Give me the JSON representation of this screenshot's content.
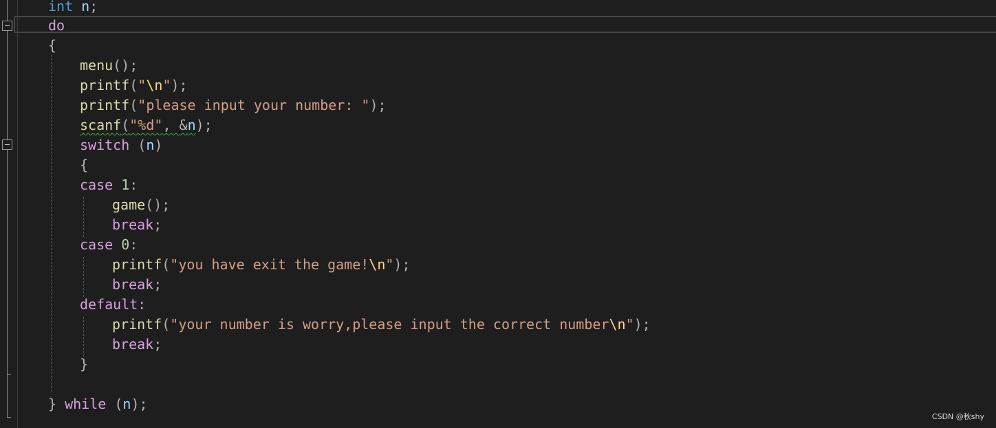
{
  "editor": {
    "lines": [
      {
        "tokens": [
          {
            "t": "int",
            "c": "kw"
          },
          {
            "t": " "
          },
          {
            "t": "n",
            "c": "var"
          },
          {
            "t": ";",
            "c": "punct"
          }
        ]
      },
      {
        "tokens": [
          {
            "t": "do",
            "c": "ctrl"
          }
        ]
      },
      {
        "tokens": [
          {
            "t": "{",
            "c": "punct"
          }
        ]
      },
      {
        "tokens": [
          {
            "t": "menu",
            "c": "fn"
          },
          {
            "t": "();",
            "c": "punct"
          }
        ]
      },
      {
        "tokens": [
          {
            "t": "printf",
            "c": "fn"
          },
          {
            "t": "(",
            "c": "punct"
          },
          {
            "t": "\"",
            "c": "str"
          },
          {
            "t": "\\n",
            "c": "esc"
          },
          {
            "t": "\"",
            "c": "str"
          },
          {
            "t": ");",
            "c": "punct"
          }
        ]
      },
      {
        "tokens": [
          {
            "t": "printf",
            "c": "fn"
          },
          {
            "t": "(",
            "c": "punct"
          },
          {
            "t": "\"please input your number: \"",
            "c": "str"
          },
          {
            "t": ");",
            "c": "punct"
          }
        ]
      },
      {
        "tokens": [
          {
            "t": "scanf",
            "c": "fn",
            "sq": true
          },
          {
            "t": "(",
            "c": "punct",
            "sq": true
          },
          {
            "t": "\"%d\"",
            "c": "str",
            "sq": true
          },
          {
            "t": ", ",
            "c": "punct",
            "sq": true
          },
          {
            "t": "&",
            "c": "punct",
            "sq": true
          },
          {
            "t": "n",
            "c": "var",
            "sq": true
          },
          {
            "t": ");",
            "c": "punct"
          }
        ]
      },
      {
        "tokens": [
          {
            "t": "switch",
            "c": "ctrl"
          },
          {
            "t": " (",
            "c": "punct"
          },
          {
            "t": "n",
            "c": "var"
          },
          {
            "t": ")",
            "c": "punct"
          }
        ]
      },
      {
        "tokens": [
          {
            "t": "{",
            "c": "punct"
          }
        ]
      },
      {
        "tokens": [
          {
            "t": "case",
            "c": "ctrl"
          },
          {
            "t": " "
          },
          {
            "t": "1",
            "c": "num"
          },
          {
            "t": ":",
            "c": "punct"
          }
        ]
      },
      {
        "tokens": [
          {
            "t": "game",
            "c": "fn"
          },
          {
            "t": "();",
            "c": "punct"
          }
        ]
      },
      {
        "tokens": [
          {
            "t": "break",
            "c": "ctrl"
          },
          {
            "t": ";",
            "c": "punct"
          }
        ]
      },
      {
        "tokens": [
          {
            "t": "case",
            "c": "ctrl"
          },
          {
            "t": " "
          },
          {
            "t": "0",
            "c": "num"
          },
          {
            "t": ":",
            "c": "punct"
          }
        ]
      },
      {
        "tokens": [
          {
            "t": "printf",
            "c": "fn"
          },
          {
            "t": "(",
            "c": "punct"
          },
          {
            "t": "\"you have exit the game!",
            "c": "str"
          },
          {
            "t": "\\n",
            "c": "esc"
          },
          {
            "t": "\"",
            "c": "str"
          },
          {
            "t": ");",
            "c": "punct"
          }
        ]
      },
      {
        "tokens": [
          {
            "t": "break",
            "c": "ctrl"
          },
          {
            "t": ";",
            "c": "punct"
          }
        ]
      },
      {
        "tokens": [
          {
            "t": "default",
            "c": "ctrl"
          },
          {
            "t": ":",
            "c": "punct"
          }
        ]
      },
      {
        "tokens": [
          {
            "t": "printf",
            "c": "fn"
          },
          {
            "t": "(",
            "c": "punct"
          },
          {
            "t": "\"your number is worry,please input the correct number",
            "c": "str"
          },
          {
            "t": "\\n",
            "c": "esc"
          },
          {
            "t": "\"",
            "c": "str"
          },
          {
            "t": ");",
            "c": "punct"
          }
        ]
      },
      {
        "tokens": [
          {
            "t": "break",
            "c": "ctrl"
          },
          {
            "t": ";",
            "c": "punct"
          }
        ]
      },
      {
        "tokens": [
          {
            "t": "}",
            "c": "punct"
          }
        ]
      },
      {
        "tokens": []
      },
      {
        "tokens": [
          {
            "t": "}",
            "c": "punct"
          },
          {
            "t": " "
          },
          {
            "t": "while",
            "c": "ctrl"
          },
          {
            "t": " (",
            "c": "punct"
          },
          {
            "t": "n",
            "c": "var"
          },
          {
            "t": ");",
            "c": "punct"
          }
        ]
      }
    ]
  },
  "colors": {
    "background": "#1e1e1e",
    "keyword": "#569cd6",
    "control": "#d8a0df",
    "function": "#dcdcaa",
    "string": "#d69d85",
    "escape": "#ffd68f",
    "variable": "#9cdcfe",
    "number": "#b5cea8",
    "punctuation": "#b4b4b4",
    "squiggle": "#3fae3f"
  },
  "watermark": "CSDN @秋shy"
}
